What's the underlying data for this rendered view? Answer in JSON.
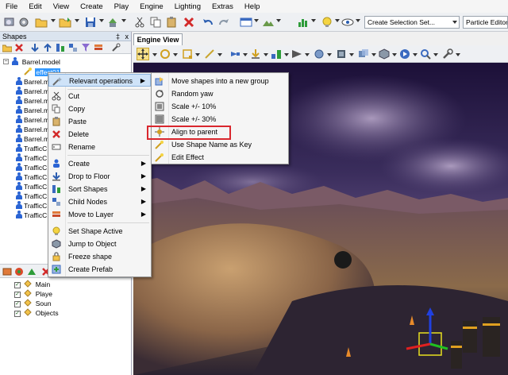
{
  "menubar": {
    "items": [
      "File",
      "Edit",
      "View",
      "Create",
      "Play",
      "Engine",
      "Lighting",
      "Extras",
      "Help"
    ]
  },
  "toolbar": {
    "selection_set_value": "Create Selection Set...",
    "particle_editor_label": "Particle Editor"
  },
  "shapes_panel": {
    "title": "Shapes",
    "pin_glyph": "‡",
    "close_glyph": "x",
    "tree": {
      "root": "Barrel.model",
      "selected_child": "effect01",
      "items": [
        "Barrel.m",
        "Barrel.m",
        "Barrel.m",
        "Barrel.m",
        "Barrel.m",
        "Barrel.m",
        "Barrel.m",
        "TrafficC",
        "TrafficC",
        "TrafficC",
        "TrafficC",
        "TrafficC",
        "TrafficC",
        "TrafficC",
        "TrafficC"
      ]
    },
    "layers": [
      "Main",
      "Playe",
      "Soun",
      "Objects"
    ]
  },
  "engine_view": {
    "tab_label": "Engine View"
  },
  "context_menu": {
    "relevant_operations": "Relevant operations",
    "cut": "Cut",
    "copy": "Copy",
    "paste": "Paste",
    "delete": "Delete",
    "rename": "Rename",
    "create": "Create",
    "drop_to_floor": "Drop to Floor",
    "sort_shapes": "Sort Shapes",
    "child_nodes": "Child Nodes",
    "move_to_layer": "Move to Layer",
    "set_shape_active": "Set Shape Active",
    "jump_to_object": "Jump to Object",
    "freeze_shape": "Freeze shape",
    "create_prefab": "Create Prefab"
  },
  "submenu": {
    "move_shapes_group": "Move shapes into a new group",
    "random_yaw": "Random yaw",
    "scale_10": "Scale +/- 10%",
    "scale_30": "Scale +/- 30%",
    "align_to_parent": "Align to parent",
    "use_shape_name": "Use Shape Name as Key",
    "edit_effect": "Edit Effect"
  },
  "colors": {
    "highlight": "#d9272e",
    "selection": "#3399ff",
    "menu_hover": "#cfe3f8"
  }
}
